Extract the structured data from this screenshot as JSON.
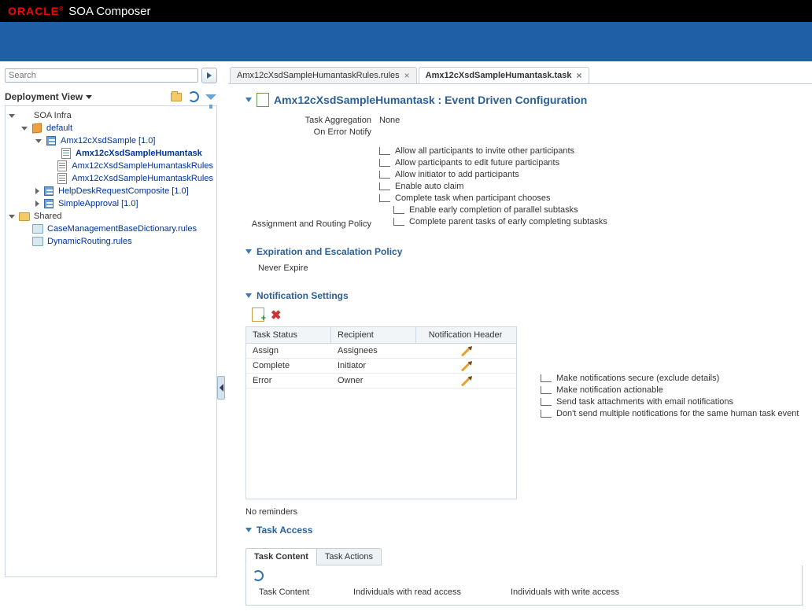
{
  "header": {
    "logo": "ORACLE",
    "trademark": "®",
    "appTitle": "SOA Composer"
  },
  "search": {
    "placeholder": "Search"
  },
  "sidebar": {
    "viewLabel": "Deployment View",
    "tree": {
      "root": "SOA Infra",
      "defaultLabel": "default",
      "comp1": "Amx12cXsdSample [1.0]",
      "task1": "Amx12cXsdSampleHumantask",
      "rules1": "Amx12cXsdSampleHumantaskRules",
      "rules2": "Amx12cXsdSampleHumantaskRules",
      "comp2": "HelpDeskRequestComposite [1.0]",
      "comp3": "SimpleApproval [1.0]",
      "shared": "Shared",
      "dict1": "CaseManagementBaseDictionary.rules",
      "dict2": "DynamicRouting.rules"
    }
  },
  "tabs": [
    {
      "label": "Amx12cXsdSampleHumantaskRules.rules"
    },
    {
      "label": "Amx12cXsdSampleHumantask.task"
    }
  ],
  "page": {
    "title": "Amx12cXsdSampleHumantask : Event Driven Configuration",
    "taskAggLabel": "Task Aggregation",
    "taskAggValue": "None",
    "onErrorLabel": "On Error Notify",
    "routingLabel": "Assignment and Routing Policy",
    "routingOptions": [
      "Allow all participants to invite other participants",
      "Allow participants to edit future participants",
      "Allow initiator to add participants",
      "Enable auto claim",
      "Complete task when participant chooses"
    ],
    "routingSubOptions": [
      "Enable early completion of parallel subtasks",
      "Complete parent tasks of early completing subtasks"
    ],
    "expirationTitle": "Expiration and Escalation Policy",
    "expirationValue": "Never Expire",
    "notifTitle": "Notification Settings",
    "notifTable": {
      "h1": "Task Status",
      "h2": "Recipient",
      "h3": "Notification Header",
      "rows": [
        {
          "status": "Assign",
          "recipient": "Assignees"
        },
        {
          "status": "Complete",
          "recipient": "Initiator"
        },
        {
          "status": "Error",
          "recipient": "Owner"
        }
      ]
    },
    "notifOptions": [
      "Make notifications secure (exclude details)",
      "Make notification actionable",
      "Send task attachments with email notifications",
      "Don't send multiple notifications for the same human task event"
    ],
    "noReminders": "No reminders",
    "taskAccessTitle": "Task Access",
    "subtabs": {
      "content": "Task Content",
      "actions": "Task Actions"
    },
    "accessCols": {
      "c1": "Task Content",
      "c2": "Individuals with read access",
      "c3": "Individuals with write access"
    }
  }
}
